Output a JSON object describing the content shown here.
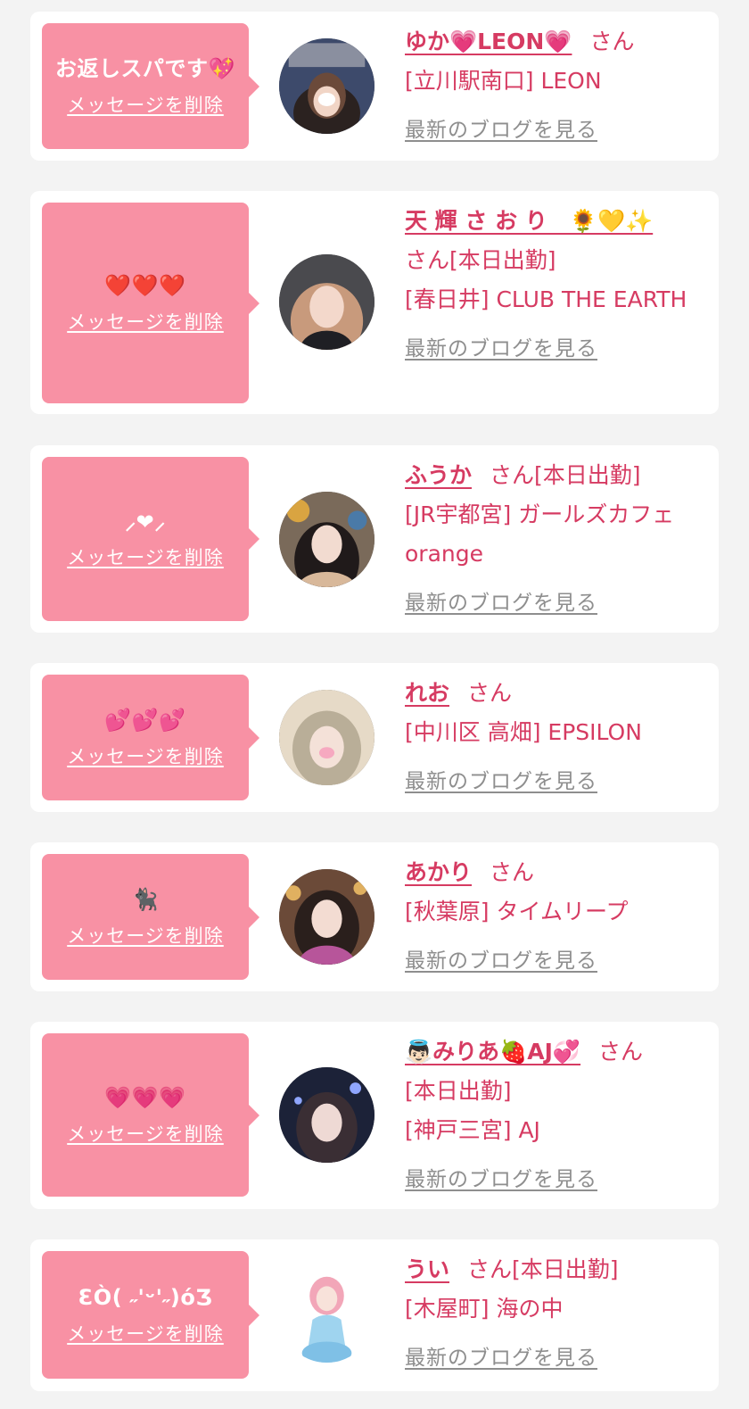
{
  "delete_label": "メッセージを削除",
  "blog_label": "最新のブログを見る",
  "san_label": "さん",
  "colors": {
    "page_bg": "#f3f3f3",
    "card_bg": "#ffffff",
    "bubble": "#f891a4",
    "accent": "#d63b62",
    "link_gray": "#8e8e8e"
  },
  "cards": [
    {
      "message": "お返しスパです💖",
      "name": "ゆか💗LEON💗",
      "lines": [
        "[立川駅南口] LEON"
      ],
      "avatar": "avatar-photo"
    },
    {
      "message": "❤️❤️❤️",
      "name": "天 輝 さ お り　🌻💛✨",
      "lines": [
        "[本日出勤]",
        "[春日井] CLUB THE EARTH"
      ],
      "avatar": "avatar-photo"
    },
    {
      "message": "⸝❤︎⸝",
      "name": "ふうか",
      "lines": [
        "[本日出勤]",
        "[JR宇都宮] ガールズカフェ orange"
      ],
      "avatar": "avatar-photo"
    },
    {
      "message": "💕💕💕",
      "name": "れお",
      "lines": [
        "[中川区 高畑] EPSILON"
      ],
      "avatar": "avatar-photo"
    },
    {
      "message": "🐈‍⬛",
      "name": "あかり",
      "lines": [
        "[秋葉原] タイムリープ"
      ],
      "avatar": "avatar-photo"
    },
    {
      "message": "💗💗💗",
      "name": "👼🏻みりあ🍓AJ💞",
      "lines": [
        "[本日出勤]",
        "[神戸三宮] AJ"
      ],
      "avatar": "avatar-photo"
    },
    {
      "message": "ƐÒ( ˶'ᵕ'˶)όƷ",
      "name": "うい",
      "lines": [
        "[本日出勤]",
        "[木屋町] 海の中"
      ],
      "avatar": "avatar-photo"
    }
  ]
}
